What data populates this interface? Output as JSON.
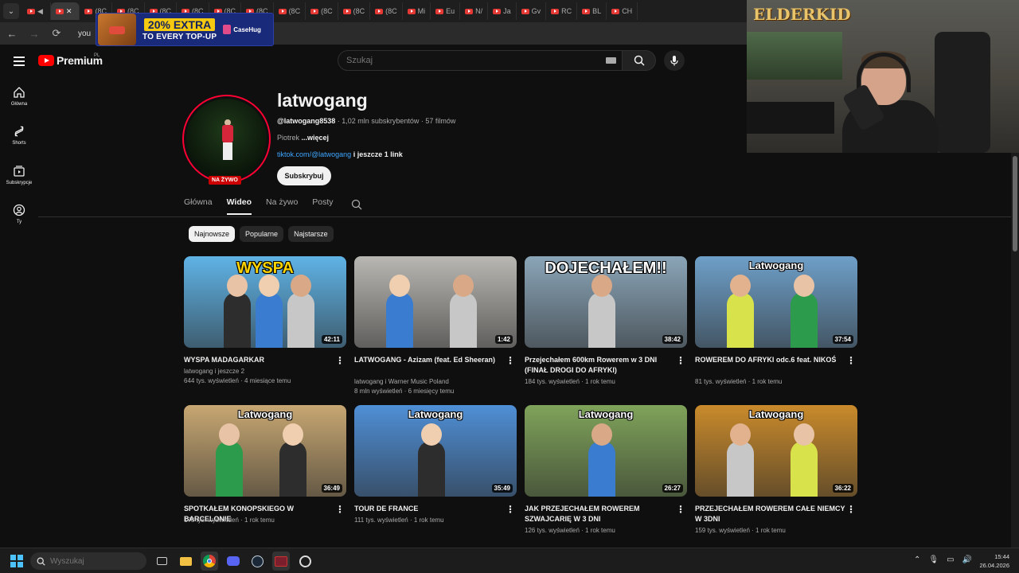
{
  "browser": {
    "tabs": [
      {
        "label": ""
      },
      {
        "label": ""
      },
      {
        "label": "(8C"
      },
      {
        "label": "(8C"
      },
      {
        "label": "(8C"
      },
      {
        "label": "(8C"
      },
      {
        "label": "(8C"
      },
      {
        "label": "(8C"
      },
      {
        "label": "(8C"
      },
      {
        "label": "(8C"
      },
      {
        "label": "(8C"
      },
      {
        "label": "(8C"
      },
      {
        "label": "Mi"
      },
      {
        "label": "Eu"
      },
      {
        "label": "N/"
      },
      {
        "label": "Ja"
      },
      {
        "label": "Gv"
      },
      {
        "label": "RC"
      },
      {
        "label": "BL"
      },
      {
        "label": "CH"
      }
    ],
    "url": "you"
  },
  "promo": {
    "headline": "20% EXTRA",
    "subline": "TO EVERY TOP-UP",
    "brand": "CaseHug"
  },
  "webcam": {
    "logo": "ELDERKID"
  },
  "youtube": {
    "logo_text": "Premium",
    "region": "PL",
    "search_placeholder": "Szukaj",
    "sidebar": [
      {
        "label": "Główna",
        "icon": "home-icon"
      },
      {
        "label": "Shorts",
        "icon": "shorts-icon"
      },
      {
        "label": "Subskrypcje",
        "icon": "subscriptions-icon"
      },
      {
        "label": "Ty",
        "icon": "you-icon"
      }
    ]
  },
  "channel": {
    "name": "latwogang",
    "handle": "@latwogang8538",
    "meta": " · 1,02 mln subskrybentów · 57 filmów",
    "desc_prefix": "Piotrek ",
    "desc_more": "...więcej",
    "link": "tiktok.com/@latwogang",
    "link_more": " i jeszcze 1 link",
    "subscribe_label": "Subskrybuj",
    "live_badge": "NA ŻYWO",
    "tabs": [
      "Główna",
      "Wideo",
      "Na żywo",
      "Posty"
    ],
    "active_tab": "Wideo",
    "chips": [
      "Najnowsze",
      "Popularne",
      "Najstarsze"
    ]
  },
  "videos": [
    {
      "title": "WYSPA MADAGARKAR",
      "channel": "latwogang i jeszcze 2",
      "stats": "644 tys. wyświetleń · 4 miesiące temu",
      "duration": "42:11",
      "thumb_text": "WYSPA",
      "bg": "#5fb3e6"
    },
    {
      "title": "LATWOGANG - Azizam (feat. Ed Sheeran)",
      "channel": "latwogang i Warner Music Poland",
      "stats": "8 mln wyświetleń · 6 miesięcy temu",
      "duration": "1:42",
      "thumb_text": "",
      "bg": "#b9b7b2"
    },
    {
      "title": "Przejechałem 600km Rowerem w 3 DNI (FINAŁ DROGI DO AFRYKI)",
      "channel": "",
      "stats": "184 tys. wyświetleń · 1 rok temu",
      "duration": "38:42",
      "thumb_text": "DOJECHAŁEM!!",
      "bg": "#8aa5b8"
    },
    {
      "title": "ROWEREM DO AFRYKI odc.6 feat. NIKOŚ",
      "channel": "",
      "stats": "81 tys. wyświetleń · 1 rok temu",
      "duration": "37:54",
      "thumb_text": "Latwogang",
      "bg": "#6e9fc8"
    },
    {
      "title": "SPOTKAŁEM KONOPSKIEGO W BARCELONIE",
      "channel": "",
      "stats": "178 tys. wyświetleń · 1 rok temu",
      "duration": "36:49",
      "thumb_text": "Latwogang",
      "bg": "#c7a772"
    },
    {
      "title": "TOUR DE FRANCE",
      "channel": "",
      "stats": "111 tys. wyświetleń · 1 rok temu",
      "duration": "35:49",
      "thumb_text": "Latwogang",
      "bg": "#4f8fd6"
    },
    {
      "title": "JAK PRZEJECHAŁEM ROWEREM SZWAJCARIĘ W 3 DNI",
      "channel": "",
      "stats": "126 tys. wyświetleń · 1 rok temu",
      "duration": "26:27",
      "thumb_text": "Latwogang",
      "bg": "#7fa35a"
    },
    {
      "title": "PRZEJECHAŁEM ROWEREM CAŁE NIEMCY W 3DNI",
      "channel": "",
      "stats": "159 tys. wyświetleń · 1 rok temu",
      "duration": "36:22",
      "thumb_text": "Latwogang",
      "bg": "#c98a2b"
    }
  ],
  "taskbar": {
    "search_placeholder": "Wyszukaj",
    "time": "15:44",
    "date": "26.04.2026"
  }
}
